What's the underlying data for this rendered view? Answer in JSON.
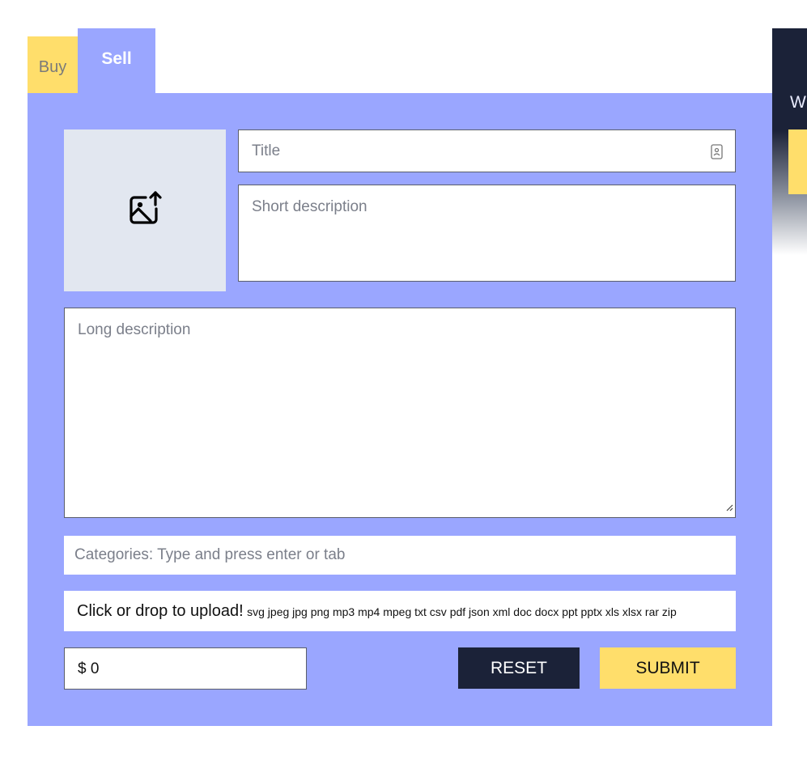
{
  "tabs": {
    "buy_label": "Buy",
    "sell_label": "Sell",
    "active": "Sell"
  },
  "form": {
    "title_placeholder": "Title",
    "short_description_placeholder": "Short description",
    "long_description_placeholder": "Long description",
    "categories_placeholder": "Categories: Type and press enter or tab",
    "upload_label": "Click or drop to upload!",
    "upload_types": "svg jpeg jpg png mp3 mp4 mpeg txt csv pdf json xml doc docx ppt pptx xls xlsx rar zip",
    "price_value": "$ 0",
    "reset_label": "RESET",
    "submit_label": "SUBMIT"
  },
  "side_panel": {
    "text": "W"
  },
  "icons": {
    "image_upload": "image-upload-icon",
    "contact_card": "contact-card-icon",
    "resize": "resize-handle-icon"
  },
  "colors": {
    "panel": "#9aa6ff",
    "tab_buy": "#ffde6b",
    "dark": "#1b2238",
    "submit": "#ffde6b",
    "image_box": "#e2e7f0"
  }
}
